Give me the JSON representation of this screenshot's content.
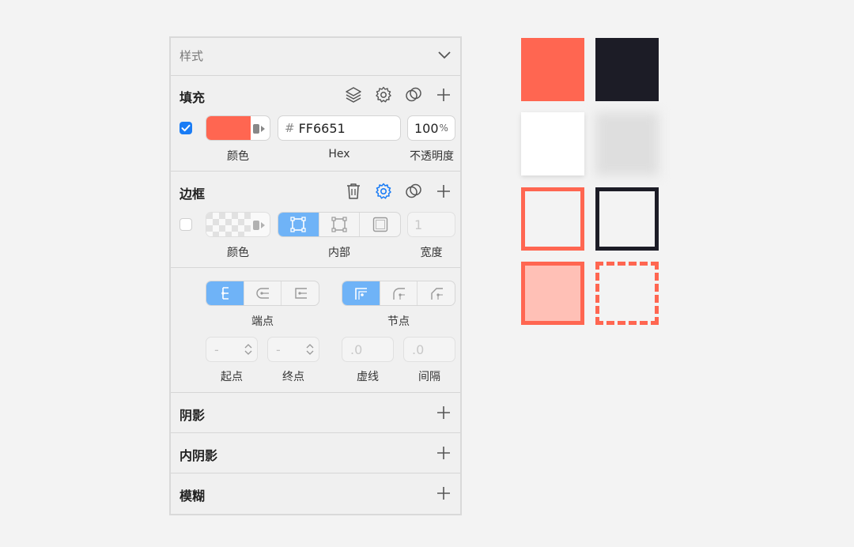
{
  "panel": {
    "header": {
      "title": "样式"
    },
    "fill": {
      "title": "填充",
      "hex_prefix": "#",
      "hex_value": "FF6651",
      "opacity_value": "100",
      "opacity_unit": "%",
      "color_label": "颜色",
      "hex_label": "Hex",
      "opacity_label": "不透明度",
      "color": "#FF6651",
      "enabled": true
    },
    "border": {
      "title": "边框",
      "width_placeholder": "1",
      "color_label": "颜色",
      "position_label": "内部",
      "width_label": "宽度",
      "enabled": false
    },
    "stroke": {
      "cap_label": "端点",
      "join_label": "节点",
      "start_placeholder": "-",
      "end_placeholder": "-",
      "dash_placeholder": ".0",
      "gap_placeholder": ".0",
      "start_label": "起点",
      "end_label": "终点",
      "dash_label": "虚线",
      "gap_label": "间隔"
    },
    "shadow": {
      "title": "阴影"
    },
    "inner_shadow": {
      "title": "内阴影"
    },
    "blur": {
      "title": "模糊"
    }
  },
  "colors": {
    "accent": "#FF6651",
    "dark": "#1C1C26",
    "light_fill": "#FFC0B6",
    "selected_blue": "#1A7CF5"
  }
}
